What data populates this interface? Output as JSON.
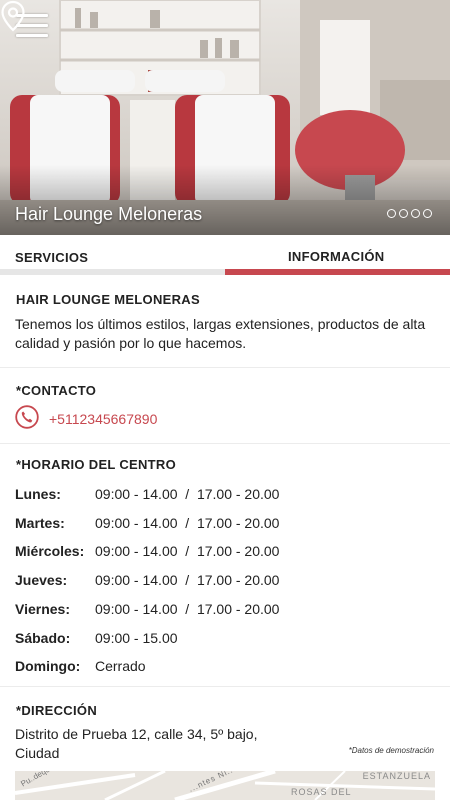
{
  "hero": {
    "title": "Hair Lounge Meloneras",
    "slide_count": 4,
    "menu_icon": "hamburger-menu-icon",
    "location_icon": "location-pin-icon"
  },
  "tabs": [
    {
      "label": "SERVICIOS",
      "active": false
    },
    {
      "label": "INFORMACIÓN",
      "active": true
    }
  ],
  "colors": {
    "accent": "#c7484f",
    "tab_inactive": "#e6e6e6"
  },
  "about": {
    "title": "HAIR LOUNGE MELONERAS",
    "text": "Tenemos los últimos estilos, largas extensiones, productos de alta calidad y pasión por lo que hacemos."
  },
  "contact": {
    "title": "*CONTACTO",
    "phone": "+5112345667890",
    "phone_icon": "phone-icon"
  },
  "hours": {
    "title": "*HORARIO DEL CENTRO",
    "rows": [
      {
        "day": "Lunes:",
        "time": "09:00 - 14.00  /  17.00 - 20.00"
      },
      {
        "day": "Martes:",
        "time": "09:00 - 14.00  /  17.00 - 20.00"
      },
      {
        "day": "Miércoles:",
        "time": "09:00 - 14.00  /  17.00 - 20.00"
      },
      {
        "day": "Jueves:",
        "time": "09:00 - 14.00  /  17.00 - 20.00"
      },
      {
        "day": "Viernes:",
        "time": "09:00 - 14.00  /  17.00 - 20.00"
      },
      {
        "day": "Sábado:",
        "time": "09:00 - 15.00"
      },
      {
        "day": "Domingo:",
        "time": "Cerrado"
      }
    ]
  },
  "address": {
    "title": "*DIRECCIÓN",
    "line1": "Distrito de Prueba 12, calle 34, 5º bajo,",
    "line2": "Ciudad",
    "note": "*Datos de demostración"
  },
  "map": {
    "labels": [
      "Pu..dequa",
      "...ntes Ni..",
      "ESTANZUELA",
      "ROSAS DEL"
    ]
  }
}
